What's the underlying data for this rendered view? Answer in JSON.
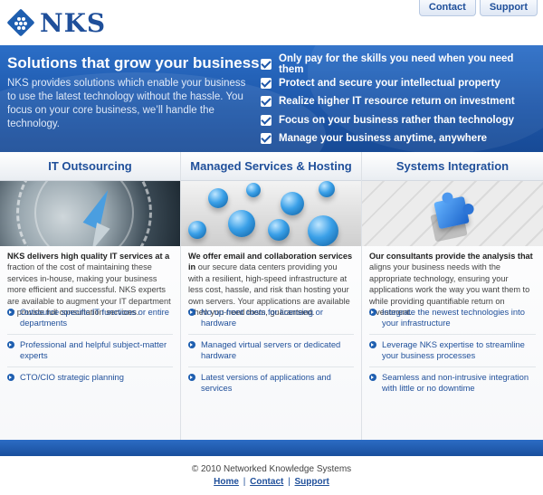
{
  "brand": {
    "name": "NKS",
    "accent": "#1f4f9a"
  },
  "top_nav": [
    {
      "label": "Contact"
    },
    {
      "label": "Support"
    }
  ],
  "banner": {
    "title": "Solutions that grow your business",
    "description": "NKS provides solutions which enable your business to use the latest technology without the hassle. You focus on your core business, we’ll handle the technology.",
    "benefits": [
      "Only pay for the skills you need when you need them",
      "Protect and secure your intellectual property",
      "Realize higher IT resource return on investment",
      "Focus on your business rather than technology",
      "Manage your business anytime, anywhere"
    ]
  },
  "columns": [
    {
      "title": "IT Outsourcing",
      "image_icon": "compass-image",
      "lead": "NKS delivers high quality IT services at a",
      "body": "fraction of the cost of maintaining these services in-house, making your business more efficient and successful. NKS experts are available to augment your IT department or provide full consultation services.",
      "items": [
        "Outsource specific IT functions or entire departments",
        "Professional and helpful subject-matter experts",
        "CTO/CIO strategic planning"
      ]
    },
    {
      "title": "Managed Services & Hosting",
      "image_icon": "network-spheres-image",
      "lead": "We offer email and collaboration services in",
      "body": "our secure data centers providing you with a resilient, high-speed infrastructure at less cost, hassle, and risk than hosting your own servers. Your applications are available when you need them, guaranteed.",
      "items": [
        "No up-front costs for licensing or hardware",
        "Managed virtual servers or dedicated hardware",
        "Latest versions of applications and services"
      ]
    },
    {
      "title": "Systems Integration",
      "image_icon": "puzzle-piece-image",
      "lead": "Our consultants provide the analysis that",
      "body": "aligns your business needs with the appropriate technology, ensuring your applications work the way you want them to while providing quantifiable return on investment.",
      "items": [
        "Integrate the newest technologies into your infrastructure",
        "Leverage NKS expertise to streamline your business processes",
        "Seamless and non-intrusive integration with little or no downtime"
      ]
    }
  ],
  "footer": {
    "copyright": "© 2010 Networked Knowledge Systems",
    "links": [
      "Home",
      "Contact",
      "Support"
    ],
    "separator": "|"
  }
}
